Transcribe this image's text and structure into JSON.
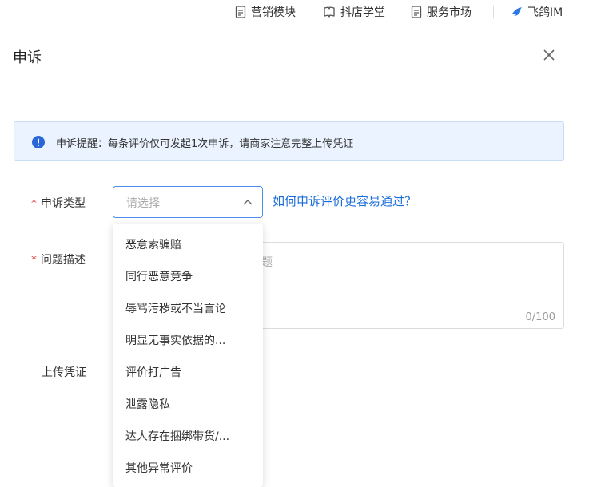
{
  "topbar": {
    "items": [
      {
        "label": "营销模块",
        "icon": "document-icon"
      },
      {
        "label": "抖店学堂",
        "icon": "book-icon"
      },
      {
        "label": "服务市场",
        "icon": "document-icon"
      },
      {
        "label": "飞鸽IM",
        "icon": "bird-icon"
      }
    ]
  },
  "dialog": {
    "title": "申诉",
    "notice": "申诉提醒：每条评价仅可发起1次申诉，请商家注意完整上传凭证",
    "form": {
      "type_label": "申诉类型",
      "type_placeholder": "请选择",
      "help_link": "如何申诉评价更容易通过？",
      "desc_label": "问题描述",
      "desc_placeholder_visible": "问题",
      "desc_count": "0/100",
      "upload_label": "上传凭证"
    },
    "dropdown_options": [
      "恶意索骗赔",
      "同行恶意竞争",
      "辱骂污秽或不当言论",
      "明显无事实依据的...",
      "评价打广告",
      "泄露隐私",
      "达人存在捆绑带货/...",
      "其他异常评价"
    ]
  },
  "colors": {
    "accent": "#4a8df0",
    "link": "#1a6dd8",
    "required": "#e4393c",
    "notice_bg": "#eaf3ff"
  }
}
